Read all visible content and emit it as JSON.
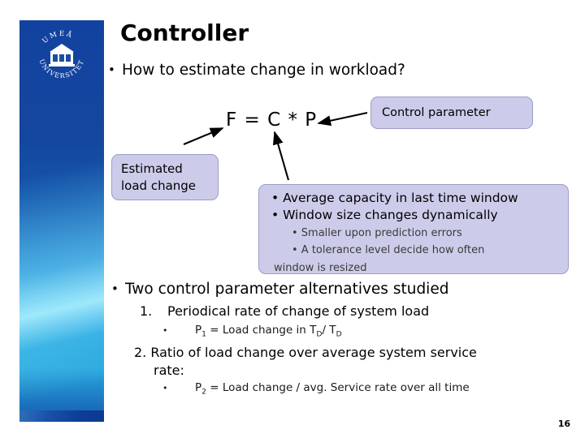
{
  "slide": {
    "title": "Controller",
    "page_number": "16",
    "logo": {
      "name": "umea-university-logo",
      "arc_top_text": "UMEÅ",
      "arc_bottom_text": "UNIVERSITET"
    }
  },
  "body": {
    "bullet_workload": {
      "marker": "•",
      "text": "How to estimate change in workload?"
    },
    "equation": "F = C * P",
    "callouts": {
      "control_parameter": "Control parameter",
      "estimated_load_change_line1": "Estimated",
      "estimated_load_change_line2": "load change",
      "capacity_box": {
        "main_bullets": [
          "• Average capacity in last time window",
          "• Window size changes dynamically"
        ],
        "sub_bullets": [
          "• Smaller upon prediction errors",
          "• A tolerance level decide how often"
        ],
        "sub_wrap_line": "window is resized"
      }
    },
    "bullet_two_alternatives": {
      "marker": "•",
      "text": "Two control parameter alternatives studied"
    },
    "numbered": [
      {
        "label": "1.",
        "text": "Periodical rate of change of system load",
        "sub_marker": "•",
        "sub_prefix": "P",
        "sub_subscript": "1",
        "sub_text_a": " = Load change in T",
        "sub_sub_a": "D",
        "sub_text_b": "/ T",
        "sub_sub_b": "D"
      },
      {
        "label": "2.",
        "text": "Ratio of load change over average system service",
        "text_wrap": "rate:",
        "sub_marker": "•",
        "sub_prefix": "P",
        "sub_subscript": "2",
        "sub_text_a": " = Load change / avg. Service rate over all time",
        "sub_sub_a": "",
        "sub_text_b": "",
        "sub_sub_b": ""
      }
    ]
  },
  "colors": {
    "callout_fill": "#ccccea",
    "callout_border": "#9c9cc8",
    "band_blue_dark": "#12429f",
    "band_blue_light": "#2aa7dd",
    "text": "#000000"
  }
}
